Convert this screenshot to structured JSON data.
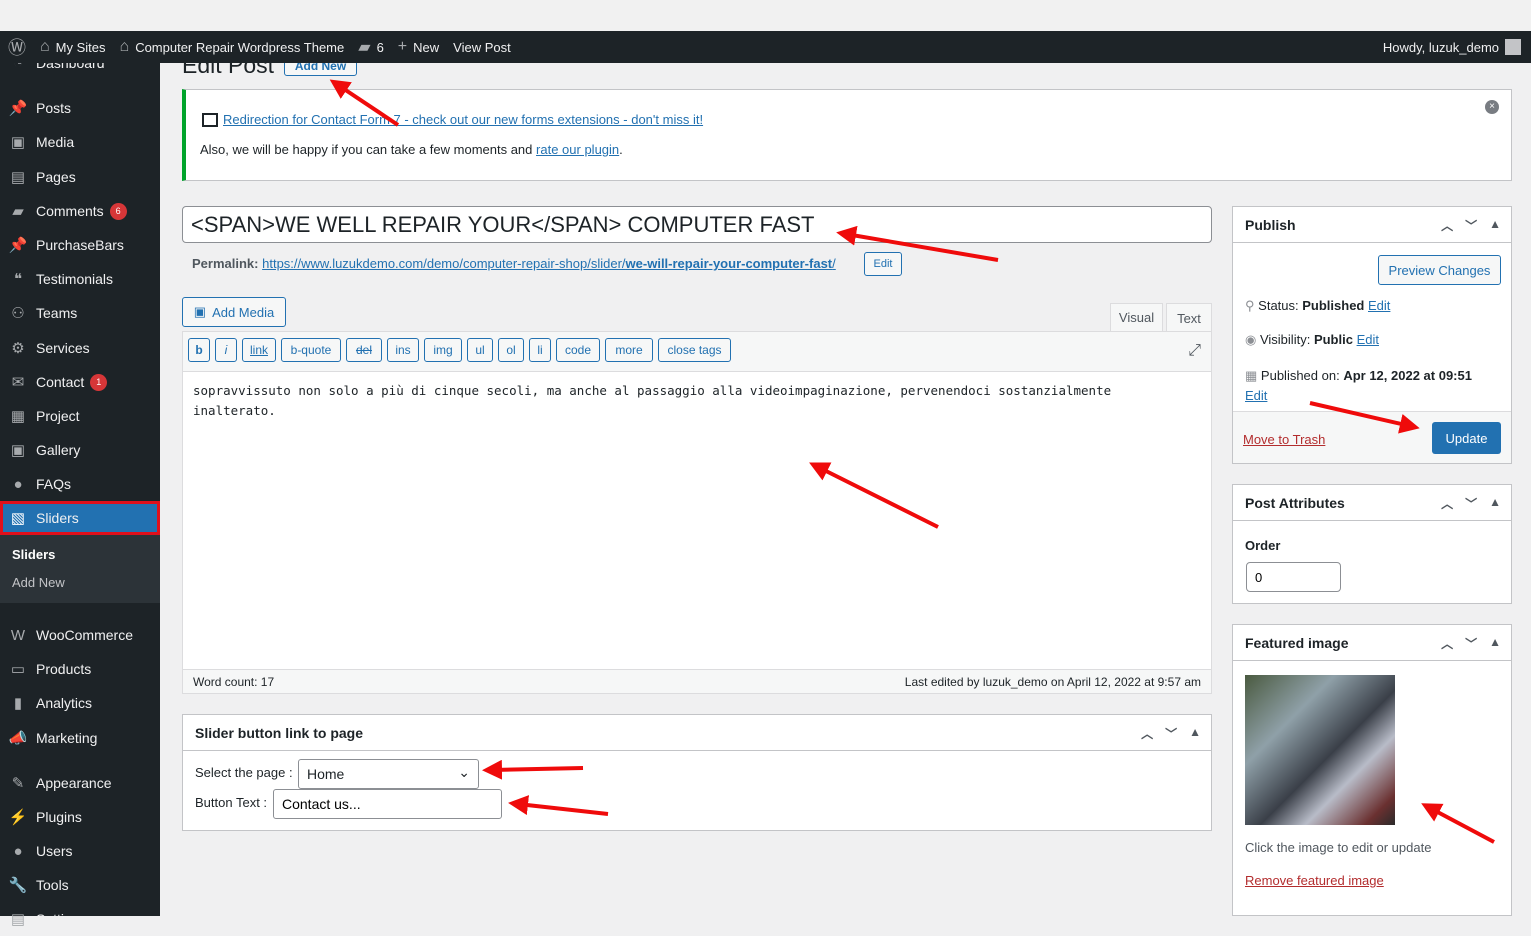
{
  "adminbar": {
    "my_sites": "My Sites",
    "site_name": "Computer Repair Wordpress Theme",
    "comments_count": "6",
    "new": "New",
    "view_post": "View Post",
    "howdy": "Howdy, luzuk_demo"
  },
  "sidebar": {
    "items": [
      {
        "label": "Dashboard",
        "icon": "dashboard-icon"
      },
      {
        "label": "Posts",
        "icon": "pin-icon"
      },
      {
        "label": "Media",
        "icon": "media-icon"
      },
      {
        "label": "Pages",
        "icon": "pages-icon"
      },
      {
        "label": "Comments",
        "icon": "comment-icon",
        "badge": "6"
      },
      {
        "label": "PurchaseBars",
        "icon": "pin-icon"
      },
      {
        "label": "Testimonials",
        "icon": "testimonial-icon"
      },
      {
        "label": "Teams",
        "icon": "groups-icon"
      },
      {
        "label": "Services",
        "icon": "services-icon"
      },
      {
        "label": "Contact",
        "icon": "mail-icon",
        "badge": "1"
      },
      {
        "label": "Project",
        "icon": "project-icon"
      },
      {
        "label": "Gallery",
        "icon": "gallery-icon"
      },
      {
        "label": "FAQs",
        "icon": "faq-icon"
      },
      {
        "label": "Sliders",
        "icon": "slides-icon"
      },
      {
        "label": "WooCommerce",
        "icon": "woo-icon"
      },
      {
        "label": "Products",
        "icon": "archive-icon"
      },
      {
        "label": "Analytics",
        "icon": "chart-icon"
      },
      {
        "label": "Marketing",
        "icon": "megaphone-icon"
      },
      {
        "label": "Appearance",
        "icon": "brush-icon"
      },
      {
        "label": "Plugins",
        "icon": "plugin-icon"
      },
      {
        "label": "Users",
        "icon": "user-icon"
      },
      {
        "label": "Tools",
        "icon": "wrench-icon"
      },
      {
        "label": "Settings",
        "icon": "settings-icon"
      }
    ],
    "submenu": [
      "Sliders",
      "Add New"
    ]
  },
  "page": {
    "title": "Edit Post",
    "add_new": "Add New"
  },
  "notice": {
    "link": "Redirection for Contact Form 7 - check out our new forms extensions - don't miss it!",
    "text": "Also, we will be happy if you can take a few moments and",
    "rate_link": "rate our plugin",
    "end": "."
  },
  "post": {
    "title": "<SPAN>WE WELL REPAIR YOUR</SPAN> COMPUTER FAST",
    "permalink_label": "Permalink:",
    "permalink_base": "https://www.luzukdemo.com/demo/computer-repair-shop/slider/",
    "permalink_slug": "we-will-repair-your-computer-fast",
    "permalink_end": "/",
    "edit": "Edit"
  },
  "editor": {
    "add_media": "Add Media",
    "tab_visual": "Visual",
    "tab_text": "Text",
    "quicktags": [
      "b",
      "i",
      "link",
      "b-quote",
      "del",
      "ins",
      "img",
      "ul",
      "ol",
      "li",
      "code",
      "more",
      "close tags"
    ],
    "content": "sopravvissuto non solo a più di cinque secoli, ma anche al passaggio alla videoimpaginazione, pervenendoci sostanzialmente inalterato.",
    "word_count": "Word count: 17",
    "last_edited": "Last edited by luzuk_demo on April 12, 2022 at 9:57 am"
  },
  "slider_box": {
    "title": "Slider button link to page",
    "select_label": "Select the page :",
    "select_value": "Home",
    "button_label": "Button Text :",
    "button_value": "Contact us..."
  },
  "publish": {
    "title": "Publish",
    "preview": "Preview Changes",
    "status_label": "Status:",
    "status": "Published",
    "visibility_label": "Visibility:",
    "visibility": "Public",
    "published_label": "Published on:",
    "published": "Apr 12, 2022 at 09:51",
    "edit": "Edit",
    "trash": "Move to Trash",
    "update": "Update"
  },
  "attributes": {
    "title": "Post Attributes",
    "order_label": "Order",
    "order_value": "0"
  },
  "featured": {
    "title": "Featured image",
    "hint": "Click the image to edit or update",
    "remove": "Remove featured image"
  },
  "colors": {
    "accent": "#2271b1",
    "annotation": "#ef0b0b",
    "sidebar": "#1d2327"
  }
}
